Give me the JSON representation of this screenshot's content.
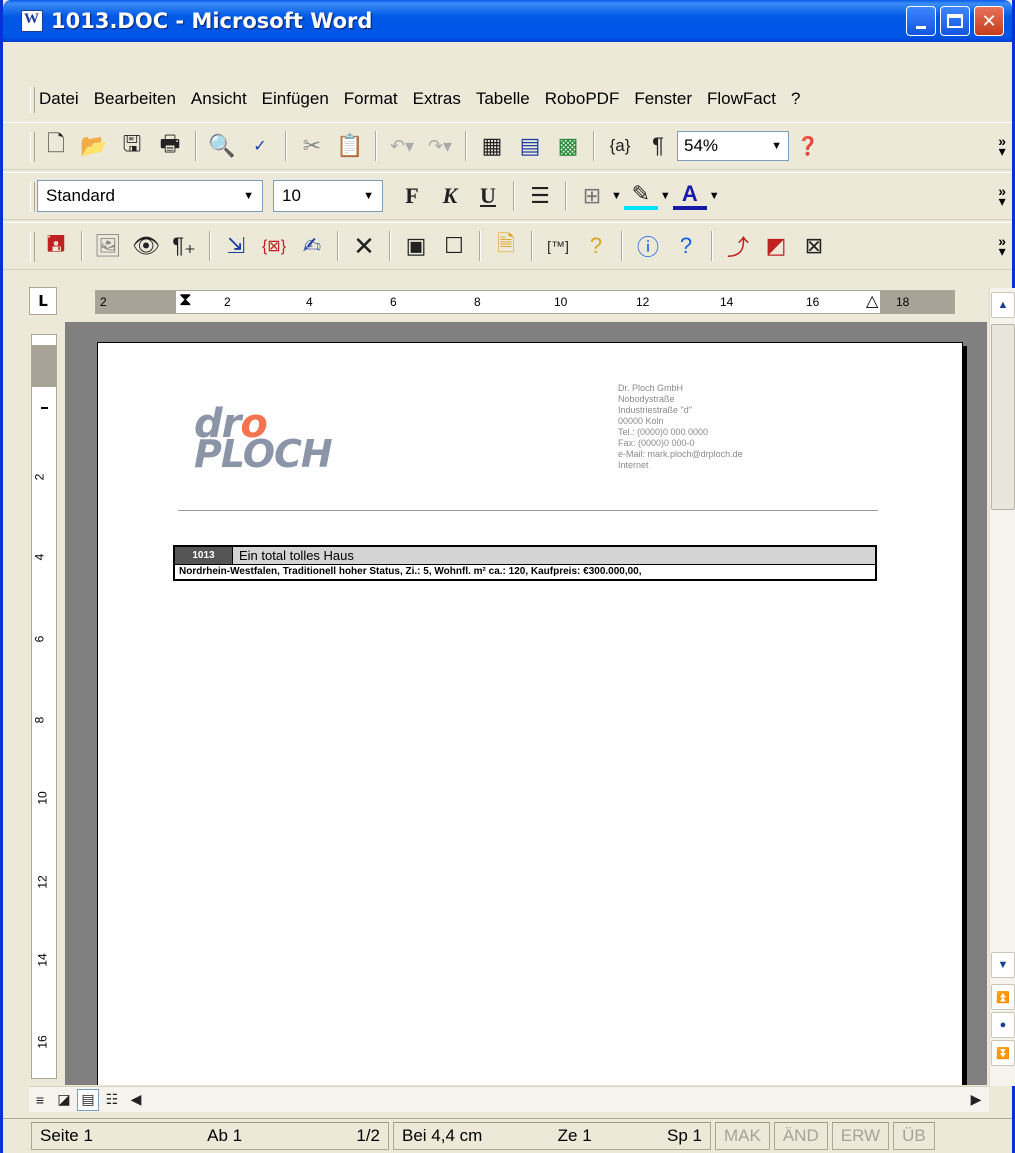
{
  "window": {
    "title": "1013.DOC - Microsoft Word"
  },
  "menubar": {
    "items": [
      "Datei",
      "Bearbeiten",
      "Ansicht",
      "Einfügen",
      "Format",
      "Extras",
      "Tabelle",
      "RoboPDF",
      "Fenster",
      "FlowFact",
      "?"
    ]
  },
  "toolbar_standard": {
    "zoom": "54%"
  },
  "toolbar_format": {
    "style": "Standard",
    "font_size": "10",
    "bold_label": "F",
    "italic_label": "K",
    "underline_label": "U"
  },
  "ruler": {
    "h_ticks": [
      "2",
      "2",
      "4",
      "6",
      "8",
      "10",
      "12",
      "14",
      "16",
      "18"
    ],
    "v_ticks": [
      "2",
      "4",
      "6",
      "8",
      "10",
      "12",
      "14",
      "16"
    ]
  },
  "document": {
    "logo_line1_a": "dr",
    "logo_line1_b": "o",
    "logo_line2": "PLOCH",
    "letterhead": [
      "Dr. Ploch GmbH",
      "Nobodystraße",
      "Industriestraße \"d\"",
      "00000 Koln",
      "Tel.: (0000)0 000 0000",
      "Fax: (0000)0 000-0",
      "e-Mail: mark.ploch@drploch.de",
      "Internet"
    ],
    "estate_id": "1013",
    "estate_title": "Ein total tolles Haus",
    "estate_details": "Nordrhein-Westfalen, Traditionell hoher Status, Zi.: 5, Wohnfl. m² ca.: 120, Kaufpreis: €300.000,00,"
  },
  "statusbar": {
    "page": "Seite  1",
    "section": "Ab  1",
    "pages": "1/2",
    "position": "Bei 4,4 cm",
    "line": "Ze 1",
    "column": "Sp 1",
    "rec": "MAK",
    "trk": "ÄND",
    "ext": "ERW",
    "ovr": "ÜB"
  }
}
